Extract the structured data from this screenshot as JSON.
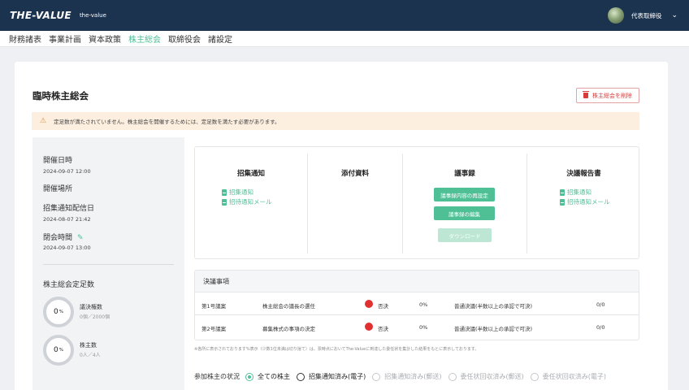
{
  "topbar": {
    "logo": "THE-VALUE",
    "logo_sub": "the-value",
    "user_name": "代表取締役",
    "chevron": "⌄"
  },
  "nav": {
    "items": [
      {
        "label": "財務諸表",
        "active": false
      },
      {
        "label": "事業計画",
        "active": false
      },
      {
        "label": "資本政策",
        "active": false
      },
      {
        "label": "株主総会",
        "active": true
      },
      {
        "label": "取締役会",
        "active": false
      },
      {
        "label": "諸設定",
        "active": false
      }
    ]
  },
  "page": {
    "title": "臨時株主総会",
    "delete_label": "株主総会を削除",
    "warning": "定足数が満たされていません。株主総会を開催するためには、定足数を満たす必要があります。"
  },
  "info": {
    "date_label": "開催日時",
    "date_value": "2024-09-07 12:00",
    "place_label": "開催場所",
    "notice_label": "招集通知配信日",
    "notice_value": "2024-08-07 21:42",
    "close_label": "閉会時間",
    "close_value": "2024-09-07 13:00",
    "quorum_label": "株主総会定足数",
    "votes_pct": "0",
    "votes_title": "議決権数",
    "votes_sub": "0個／2000個",
    "shareholders_pct": "0",
    "shareholders_title": "株主数",
    "shareholders_sub": "0人／4人",
    "pct_unit": "%"
  },
  "docs": {
    "notice": {
      "title": "招集通知",
      "link1": "招集通知",
      "link2": "招待通知メール"
    },
    "attachments": {
      "title": "添付資料"
    },
    "minutes": {
      "title": "議事録",
      "btn_reset": "議事録内容の再設定",
      "btn_edit": "議事録の編集",
      "btn_download": "ダウンロード"
    },
    "report": {
      "title": "決議報告書",
      "link1": "招集通知",
      "link2": "招待通知メール"
    }
  },
  "resolutions": {
    "title": "決議事項",
    "rows": [
      {
        "no": "第1号議案",
        "name": "株主総会の議長の選任",
        "result": "否決",
        "pct": "0%",
        "rule": "普通決議(半数以上の承認で可決)",
        "count": "0/0"
      },
      {
        "no": "第2号議案",
        "name": "募集株式の事項の決定",
        "result": "否決",
        "pct": "0%",
        "rule": "普通決議(半数以上の承認で可決)",
        "count": "0/0"
      }
    ],
    "footnote": "※各所に表示されております%表示（少数1位未満は切り捨て）は、票時点においてThe-Valueに到達した委任状を集計した結果をもとに表示しております。"
  },
  "filters": {
    "label": "参加株主の状況",
    "options": [
      {
        "label": "全ての株主",
        "state": "on"
      },
      {
        "label": "招集通知済み(電子)",
        "state": "normal"
      },
      {
        "label": "招集通知済み(郵送)",
        "state": "off"
      },
      {
        "label": "委任状回収済み(郵送)",
        "state": "off"
      },
      {
        "label": "委任状回収済み(電子)",
        "state": "off"
      }
    ]
  },
  "colors": {
    "accent": "#4fbf96",
    "header": "#1c3350",
    "danger": "#e03030",
    "warning_bg": "#fcefdf"
  }
}
